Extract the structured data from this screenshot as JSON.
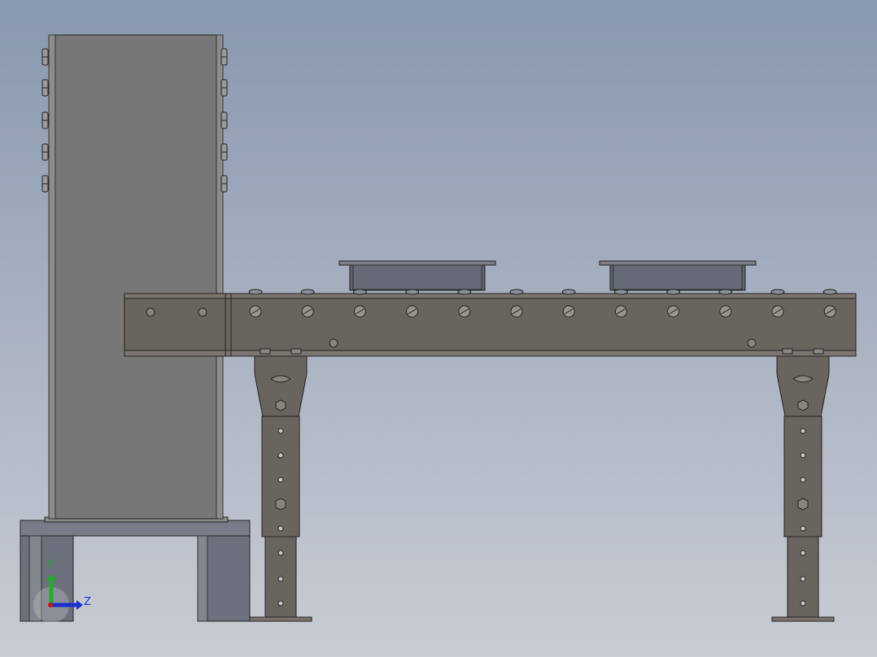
{
  "viewport": {
    "background_top": "#8898ae",
    "background_bottom": "#c9ccd3"
  },
  "model": {
    "tower_color": "#767676",
    "frame_color": "#6a645f",
    "leg_color": "#6a645f",
    "tray_color": "#5f6470",
    "base_color": "#6f7480",
    "roller_bolt_count": 12,
    "leg_hole_count": 8
  },
  "triad": {
    "y_label": "Y",
    "z_label": "Z",
    "y_color": "#1fae2a",
    "z_color": "#1a2fd0",
    "x_color": "#d01010"
  }
}
